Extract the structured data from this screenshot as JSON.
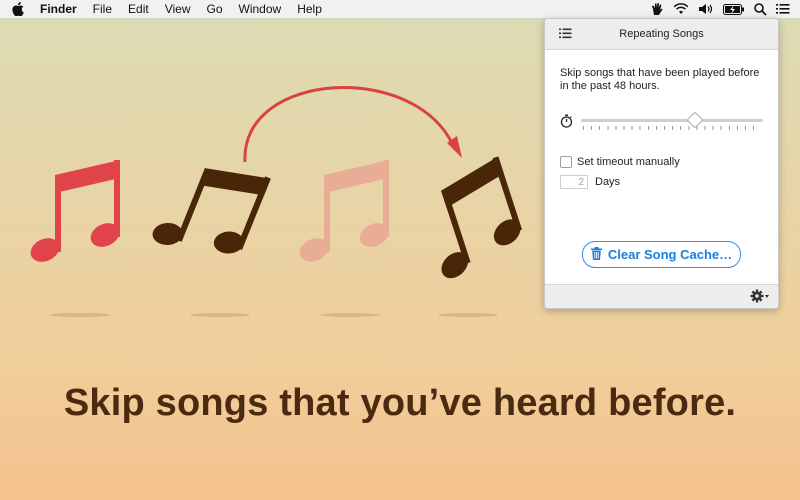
{
  "menubar": {
    "app_name": "Finder",
    "menus": [
      "File",
      "Edit",
      "View",
      "Go",
      "Window",
      "Help"
    ],
    "status_icons": [
      "hand-icon",
      "wifi-icon",
      "volume-icon",
      "battery-icon",
      "search-icon",
      "list-icon"
    ]
  },
  "headline": "Skip songs that you’ve heard before.",
  "panel": {
    "title": "Repeating Songs",
    "description": "Skip songs that have been played before in the past 48 hours.",
    "slider_value_fraction": 0.63,
    "checkbox_label": "Set timeout manually",
    "checkbox_checked": false,
    "days_placeholder": "2",
    "days_label": "Days",
    "clear_button_label": "Clear Song Cache…"
  },
  "colors": {
    "note_red": "#e0444a",
    "note_dark": "#4a2608",
    "note_faded": "#e9ad95",
    "arrow": "#d9423f",
    "button_blue": "#1a7fe0",
    "headline": "#4a2a10"
  }
}
